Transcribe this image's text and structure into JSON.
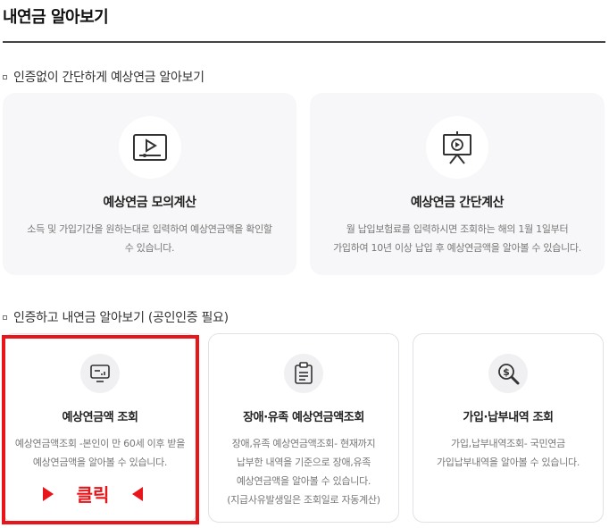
{
  "page": {
    "title": "내연금 알아보기"
  },
  "section1": {
    "heading": "인증없이 간단하게 예상연금 알아보기",
    "cards": [
      {
        "icon": "video-player-icon",
        "title": "예상연금 모의계산",
        "desc": "소득 및 가입기간을 원하는대로 입력하여 예상연금액을 확인할\n수 있습니다."
      },
      {
        "icon": "presentation-board-icon",
        "title": "예상연금 간단계산",
        "desc": "월 납입보험료를 입력하시면 조회하는 해의 1월 1일부터\n가입하여 10년 이상 납입 후 예상연금액을 알아볼 수 있습니다."
      }
    ]
  },
  "section2": {
    "heading": "인증하고 내연금 알아보기 (공인인증 필요)",
    "cards": [
      {
        "icon": "monitor-chart-icon",
        "title": "예상연금액 조회",
        "desc": "예상연금액조회 -본인이 만 60세 이후 받을\n예상연금액을 알아볼 수 있습니다."
      },
      {
        "icon": "clipboard-icon",
        "title": "장애·유족 예상연금액조회",
        "desc": "장애,유족 예상연금액조회- 현재까지\n납부한 내역을 기준으로 장애,유족\n예상연금액을 알아볼 수 있습니다.\n(지급사유발생일은 조회일로 자동계산)"
      },
      {
        "icon": "dollar-search-icon",
        "title": "가입·납부내역 조회",
        "desc": "가입,납부내역조회- 국민연금\n가입납부내역을 알아볼 수 있습니다."
      }
    ]
  },
  "annotation": {
    "click_label": "클릭",
    "color": "#e8161a"
  }
}
